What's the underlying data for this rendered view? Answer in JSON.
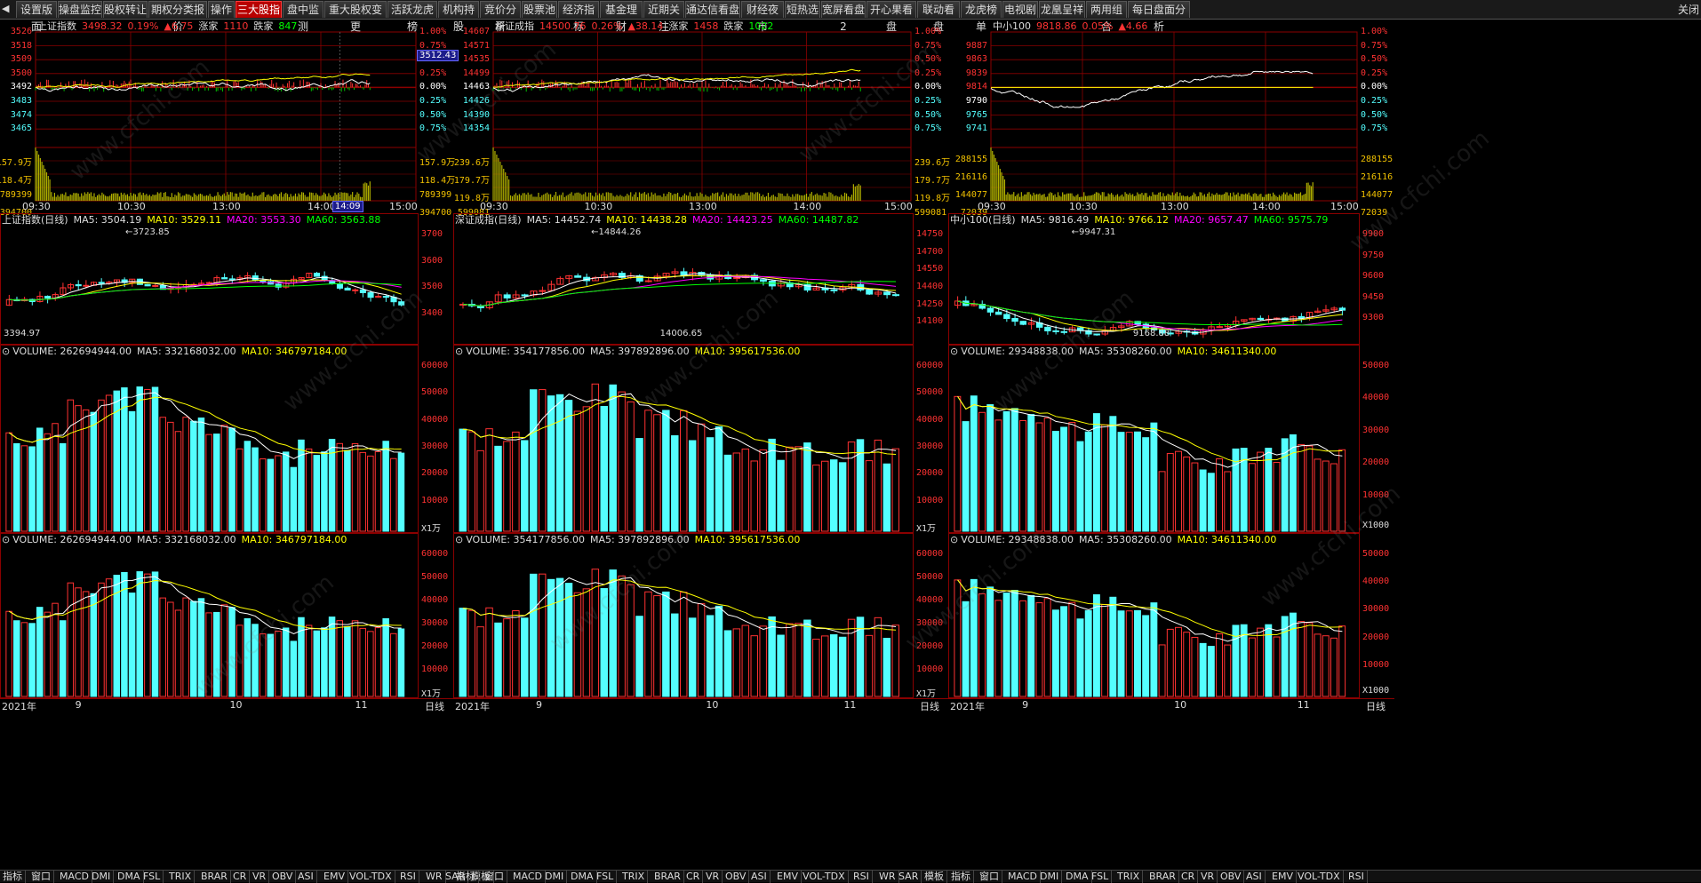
{
  "topbar": {
    "tabs": [
      "设置版面",
      "操盘监控",
      "股权转让",
      "期权分类报价",
      "操作",
      "三大股指",
      "盘中监测",
      "重大股权变更",
      "活跃龙虎榜",
      "机构持股",
      "竞价分析",
      "股票池",
      "经济指标",
      "基金理财",
      "近期关注",
      "通达信看盘",
      "财经夜市",
      "短热选",
      "宽屏看盘2",
      "开心果看盘",
      "联动看盘",
      "龙虎榜单",
      "电视剧",
      "龙凰呈祥",
      "两用组合",
      "每日盘面分析"
    ],
    "active": "三大股指",
    "close_label": "关闭"
  },
  "intraday": [
    {
      "name": "上证指数",
      "price": "3498.32",
      "pct": "0.19%",
      "chg": "▲6.75",
      "up_label": "涨家",
      "up_count": "1110",
      "down_label": "跌家",
      "down_count": "847",
      "left_ticks": [
        "3526",
        "3518",
        "3509",
        "3500",
        "3492",
        "3483",
        "3474",
        "3465"
      ],
      "right_ticks": [
        "1.00%",
        "0.75%",
        "0.50%",
        "0.25%",
        "0.00%",
        "0.25%",
        "0.50%",
        "0.75%"
      ],
      "vol_left": [
        "157.9万",
        "118.4万",
        "789399",
        "394700"
      ],
      "vol_right": [
        "157.9万",
        "118.4万",
        "789399",
        "394700"
      ],
      "price_box": "3512.43",
      "cursor_time": "14:09",
      "xlabels": [
        "09:30",
        "10:30",
        "13:00",
        "14:00",
        "15:00"
      ]
    },
    {
      "name": "深证成指",
      "price": "14500.76",
      "pct": "0.26%",
      "chg": "▲38.14",
      "up_label": "涨家",
      "up_count": "1458",
      "down_label": "跌家",
      "down_count": "1022",
      "left_ticks": [
        "14607",
        "14571",
        "14535",
        "14499",
        "14463",
        "14426",
        "14390",
        "14354"
      ],
      "right_ticks": [
        "1.00%",
        "0.75%",
        "0.50%",
        "0.25%",
        "0.00%",
        "0.25%",
        "0.50%",
        "0.75%"
      ],
      "vol_left": [
        "239.6万",
        "179.7万",
        "119.8万",
        "599081"
      ],
      "vol_right": [
        "239.6万",
        "179.7万",
        "119.8万",
        "599081"
      ],
      "xlabels": [
        "09:30",
        "10:30",
        "13:00",
        "14:00",
        "15:00"
      ]
    },
    {
      "name": "中小100",
      "price": "9818.86",
      "pct": "0.05%",
      "chg": "▲4.66",
      "left_ticks": [
        "9887",
        "9863",
        "9839",
        "9814",
        "9790",
        "9765",
        "9741"
      ],
      "left_top": "",
      "right_ticks": [
        "1.00%",
        "0.75%",
        "0.50%",
        "0.25%",
        "0.00%",
        "0.25%",
        "0.50%",
        "0.75%"
      ],
      "vol_left": [
        "288155",
        "216116",
        "144077",
        "72039"
      ],
      "vol_right": [
        "288155",
        "216116",
        "144077",
        "72039"
      ],
      "xlabels": [
        "09:30",
        "10:30",
        "13:00",
        "14:00",
        "15:00"
      ]
    }
  ],
  "daily": [
    {
      "title": "上证指数(日线)",
      "ma5": "MA5: 3504.19",
      "ma10": "MA10: 3529.11",
      "ma20": "MA20: 3553.30",
      "ma60": "MA60: 3563.88",
      "high_label": "3723.85",
      "low_label": "3394.97",
      "ticks": [
        "3700",
        "3600",
        "3500",
        "3400"
      ]
    },
    {
      "title": "深证成指(日线)",
      "ma5": "MA5: 14452.74",
      "ma10": "MA10: 14438.28",
      "ma20": "MA20: 14423.25",
      "ma60": "MA60: 14487.82",
      "high_label": "14844.26",
      "low_label": "14006.65",
      "ticks": [
        "14750",
        "14700",
        "14550",
        "14400",
        "14250",
        "14100"
      ]
    },
    {
      "title": "中小100(日线)",
      "ma5": "MA5: 9816.49",
      "ma10": "MA10: 9766.12",
      "ma20": "MA20: 9657.47",
      "ma60": "MA60: 9575.79",
      "high_label": "9947.31",
      "low_label": "9168.88",
      "ticks": [
        "9900",
        "9750",
        "9600",
        "9450",
        "9300"
      ]
    }
  ],
  "volume": [
    {
      "vol": "VOLUME: 262694944.00",
      "ma5": "MA5: 332168032.00",
      "ma10": "MA10: 346797184.00",
      "ticks": [
        "60000",
        "50000",
        "40000",
        "30000",
        "20000",
        "10000"
      ],
      "unit": "X1万"
    },
    {
      "vol": "VOLUME: 354177856.00",
      "ma5": "MA5: 397892896.00",
      "ma10": "MA10: 395617536.00",
      "ticks": [
        "60000",
        "50000",
        "40000",
        "30000",
        "20000",
        "10000"
      ],
      "unit": "X1万"
    },
    {
      "vol": "VOLUME: 29348838.00",
      "ma5": "MA5: 35308260.00",
      "ma10": "MA10: 34611340.00",
      "ticks": [
        "50000",
        "40000",
        "30000",
        "20000",
        "10000"
      ],
      "unit": "X1000"
    }
  ],
  "volume2": [
    {
      "vol": "VOLUME: 262694944.00",
      "ma5": "MA5: 332168032.00",
      "ma10": "MA10: 346797184.00",
      "ticks": [
        "60000",
        "50000",
        "40000",
        "30000",
        "20000",
        "10000"
      ],
      "unit": "X1万"
    },
    {
      "vol": "VOLUME: 354177856.00",
      "ma5": "MA5: 397892896.00",
      "ma10": "MA10: 395617536.00",
      "ticks": [
        "60000",
        "50000",
        "40000",
        "30000",
        "20000",
        "10000"
      ],
      "unit": "X1万"
    },
    {
      "vol": "VOLUME: 29348838.00",
      "ma5": "MA5: 35308260.00",
      "ma10": "MA10: 34611340.00",
      "ticks": [
        "50000",
        "40000",
        "30000",
        "20000",
        "10000"
      ],
      "unit": "X1000"
    }
  ],
  "daily_xlabels": [
    "2021年",
    "9",
    "10",
    "11"
  ],
  "period_label": "日线",
  "bottom_tabs": [
    "指标",
    "窗口",
    "MACD",
    "DMI",
    "DMA",
    "FSL",
    "TRIX",
    "BRAR",
    "CR",
    "VR",
    "OBV",
    "ASI",
    "EMV",
    "VOL-TDX",
    "RSI",
    "WR",
    "SAR",
    "模板"
  ],
  "watermark": "www.cfchi.com",
  "colors": {
    "up": "#ff3232",
    "down": "#54ffff",
    "grid": "#8b0000",
    "ma5": "#ffffff",
    "ma10": "#ffff00",
    "ma20": "#ff00ff",
    "ma60": "#00ff00"
  }
}
